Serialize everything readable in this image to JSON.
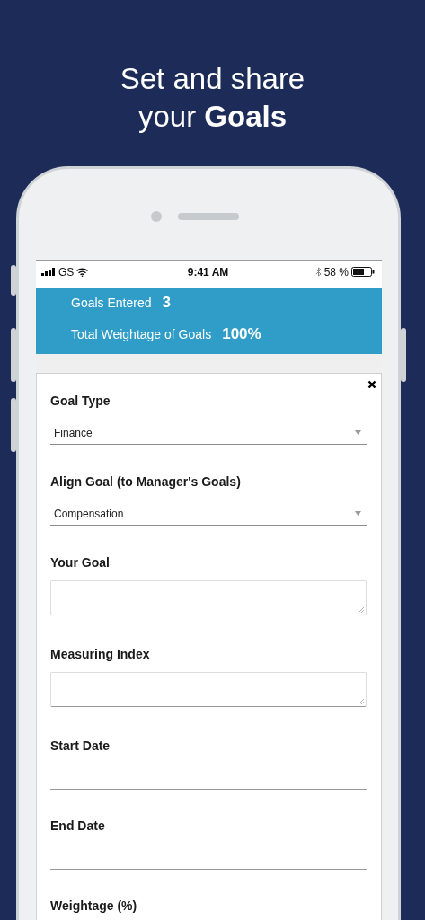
{
  "headline": {
    "lines": [
      "Set and share",
      "your **Goals**"
    ]
  },
  "status_bar": {
    "carrier": "GS",
    "time": "9:41 AM",
    "battery": "58 %"
  },
  "summary": [
    {
      "label": "Goals Entered",
      "value": "3"
    },
    {
      "label": "Total Weightage of Goals",
      "value": "100%"
    }
  ],
  "form": {
    "fields": [
      {
        "kind": "select",
        "label": "Goal Type",
        "value": "Finance"
      },
      {
        "kind": "select",
        "label": "Align Goal (to Manager's Goals)",
        "value": "Compensation"
      },
      {
        "kind": "textarea",
        "label": "Your Goal"
      },
      {
        "kind": "textarea",
        "label": "Measuring Index"
      },
      {
        "kind": "date",
        "label": "Start Date"
      },
      {
        "kind": "date",
        "label": "End Date"
      },
      {
        "kind": "heading",
        "label": "Weightage (%)"
      }
    ]
  }
}
